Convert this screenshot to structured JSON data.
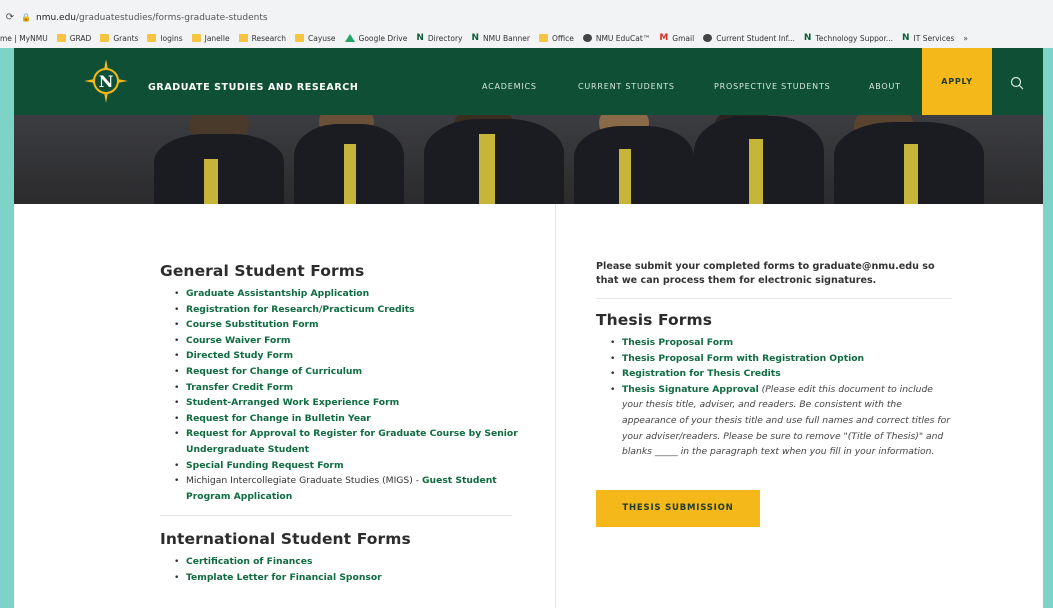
{
  "browser": {
    "url_domain": "nmu.edu",
    "url_path": "/graduatestudies/forms-graduate-students",
    "bookmarks": [
      {
        "label": "me | MyNMU",
        "icon": "none"
      },
      {
        "label": "GRAD",
        "icon": "folder"
      },
      {
        "label": "Grants",
        "icon": "folder"
      },
      {
        "label": "logins",
        "icon": "folder"
      },
      {
        "label": "Janelle",
        "icon": "folder"
      },
      {
        "label": "Research",
        "icon": "folder"
      },
      {
        "label": "Cayuse",
        "icon": "folder"
      },
      {
        "label": "Google Drive",
        "icon": "drive"
      },
      {
        "label": "Directory",
        "icon": "n"
      },
      {
        "label": "NMU Banner",
        "icon": "n"
      },
      {
        "label": "Office",
        "icon": "folder"
      },
      {
        "label": "NMU EduCat™",
        "icon": "globe"
      },
      {
        "label": "Gmail",
        "icon": "gmail"
      },
      {
        "label": "Current Student Inf...",
        "icon": "globe"
      },
      {
        "label": "Technology Suppor...",
        "icon": "n"
      },
      {
        "label": "IT Services",
        "icon": "n"
      },
      {
        "label": "»",
        "icon": "none"
      }
    ]
  },
  "nav": {
    "site_title": "GRADUATE STUDIES AND RESEARCH",
    "items": [
      "ACADEMICS",
      "CURRENT STUDENTS",
      "PROSPECTIVE STUDENTS",
      "ABOUT"
    ],
    "apply_label": "APPLY"
  },
  "general_forms": {
    "heading": "General Student Forms",
    "items": [
      {
        "link": "Graduate Assistantship Application"
      },
      {
        "link": "Registration for Research/Practicum Credits"
      },
      {
        "link": "Course Substitution Form"
      },
      {
        "link": "Course Waiver Form"
      },
      {
        "link": "Directed Study Form"
      },
      {
        "link": "Request for Change of Curriculum"
      },
      {
        "link": "Transfer Credit Form"
      },
      {
        "link": "Student-Arranged Work Experience Form"
      },
      {
        "link": "Request for Change in Bulletin Year"
      },
      {
        "link": "Request for Approval to Register for Graduate Course by Senior Undergraduate Student"
      },
      {
        "link": "Special Funding Request Form"
      }
    ],
    "migs_prefix": "Michigan Intercollegiate Graduate Studies (MIGS) - ",
    "migs_link": "Guest Student Program Application"
  },
  "international_forms": {
    "heading": "International Student Forms",
    "items": [
      {
        "link": "Certification of Finances"
      },
      {
        "link": "Template Letter for Financial Sponsor"
      }
    ]
  },
  "right": {
    "note": "Please submit your completed forms to graduate@nmu.edu so that we can process them for electronic signatures.",
    "thesis_heading": "Thesis Forms",
    "thesis_items": [
      {
        "link": "Thesis Proposal Form"
      },
      {
        "link": "Thesis Proposal Form with Registration Option"
      },
      {
        "link": "Registration for Thesis Credits"
      }
    ],
    "signature_link": "Thesis Signature Approval",
    "signature_note": " (Please edit this document to include your thesis title, adviser, and readers. Be consistent with the appearance of your thesis title and use full names and correct titles for your adviser/readers. Please be sure to remove \"(Title of Thesis)\" and blanks _____ in the paragraph text when you fill in your information.",
    "submission_button": "THESIS SUBMISSION"
  },
  "colors": {
    "nav_green": "#0e4f36",
    "link_green": "#0f6b40",
    "gold": "#f4b81a",
    "frame": "#7dd3c8"
  }
}
